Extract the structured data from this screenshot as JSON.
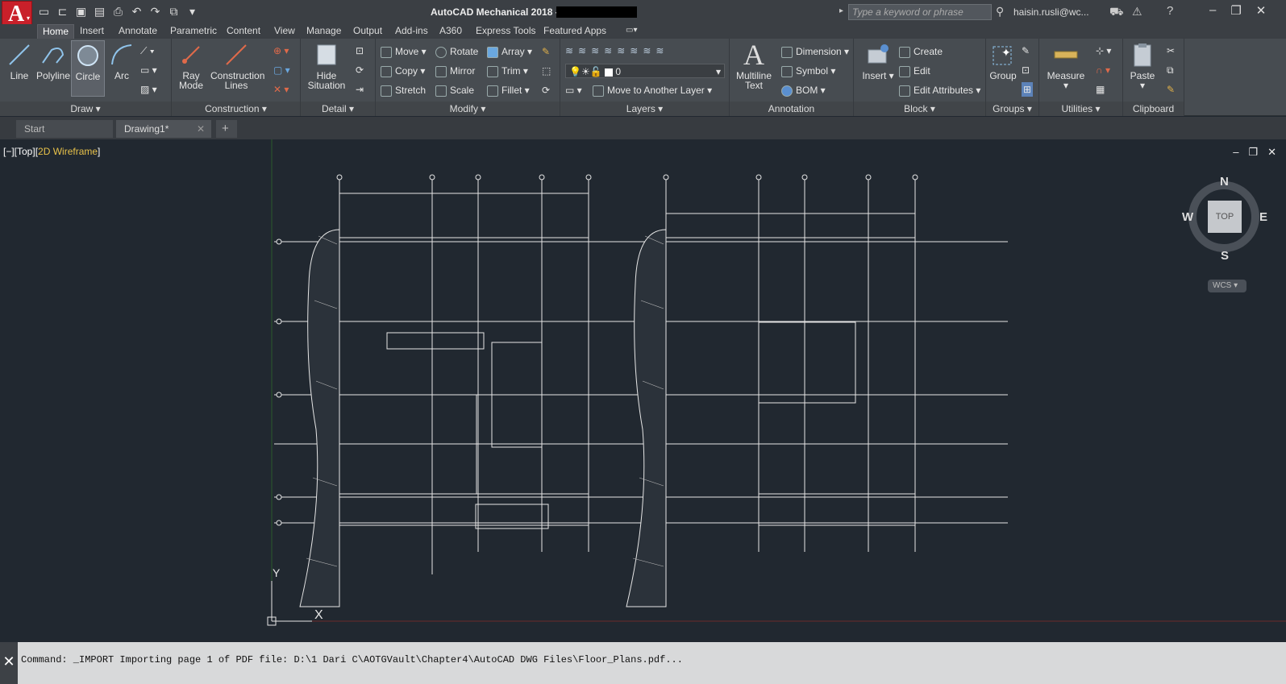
{
  "title": {
    "app_title": "AutoCAD Mechanical 2018 -",
    "app_letter": "A",
    "app_sub": "M"
  },
  "search": {
    "placeholder": "Type a keyword or phrase"
  },
  "user": {
    "name": "haisin.rusli@wc..."
  },
  "tabs": [
    "Home",
    "Insert",
    "Annotate",
    "Parametric",
    "Content",
    "View",
    "Manage",
    "Output",
    "Add-ins",
    "A360",
    "Express Tools",
    "Featured Apps"
  ],
  "panels": {
    "draw": {
      "label": "Draw",
      "line": "Line",
      "polyline": "Polyline",
      "circle": "Circle",
      "arc": "Arc"
    },
    "construction": {
      "label": "Construction",
      "ray": "Ray",
      "ray2": "Mode",
      "cl": "Construction",
      "cl2": "Lines"
    },
    "detail": {
      "label": "Detail",
      "hide": "Hide",
      "hide2": "Situation"
    },
    "modify": {
      "label": "Modify",
      "move": "Move",
      "rotate": "Rotate",
      "array": "Array",
      "copy": "Copy",
      "mirror": "Mirror",
      "trim": "Trim",
      "stretch": "Stretch",
      "scale": "Scale",
      "fillet": "Fillet"
    },
    "layers": {
      "label": "Layers",
      "layer_value": "0",
      "move_layer": "Move to Another Layer"
    },
    "annotation": {
      "label": "Annotation",
      "mtext": "Multiline",
      "mtext2": "Text",
      "dimension": "Dimension",
      "symbol": "Symbol",
      "bom": "BOM"
    },
    "block": {
      "label": "Block",
      "insert": "Insert",
      "create": "Create",
      "edit": "Edit",
      "edit_attr": "Edit Attributes"
    },
    "groups": {
      "label": "Groups",
      "group": "Group"
    },
    "utilities": {
      "label": "Utilities",
      "measure": "Measure"
    },
    "clipboard": {
      "label": "Clipboard",
      "paste": "Paste"
    }
  },
  "doc_tabs": {
    "start": "Start",
    "drawing": "Drawing1*",
    "add": "+"
  },
  "viewport": {
    "label_a": "[−][Top][",
    "label_b": "2D Wireframe",
    "label_c": "]"
  },
  "viewcube": {
    "n": "N",
    "s": "S",
    "e": "E",
    "w": "W",
    "top": "TOP",
    "wcs": "WCS"
  },
  "ucs": {
    "y": "Y",
    "x": "X"
  },
  "command": {
    "text": "Command: _IMPORT Importing page 1 of PDF file: D:\\1 Dari C\\AOTGVault\\Chapter4\\AutoCAD DWG Files\\Floor_Plans.pdf..."
  },
  "colors": {
    "canvas": "#212830",
    "ribbon": "#474c51",
    "accent_red": "#c9202a",
    "wireframe_label": "#e8c24a"
  }
}
